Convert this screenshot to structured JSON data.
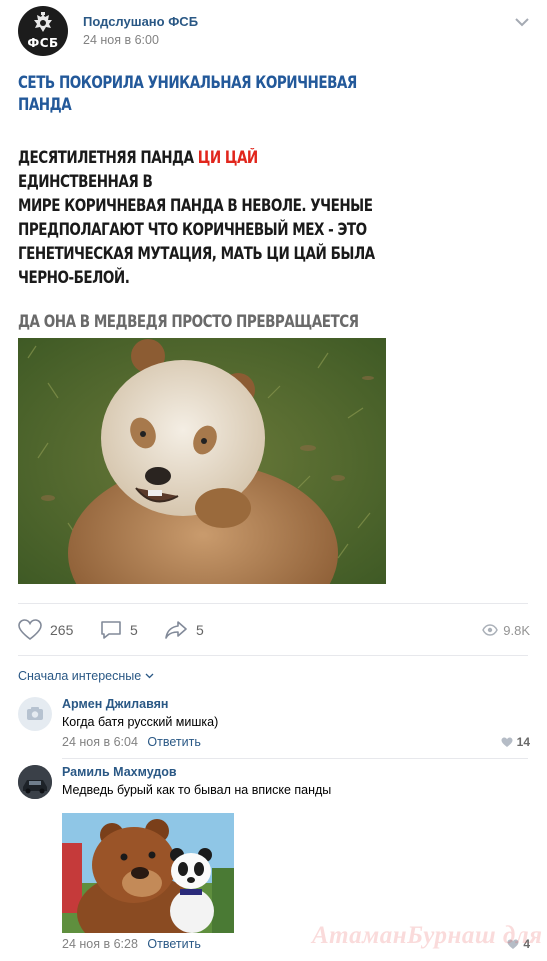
{
  "post": {
    "author": "Подслушано ФСБ",
    "avatar_text": "ФСБ",
    "date": "24 ноя в 6:00",
    "meme": {
      "title_line1": "Сеть покорила уникальная коричневая",
      "title_line2": "панда",
      "body_line1_a": "Десятилетняя панда ",
      "body_line1_red": "Ци Цай",
      "body_line1_b": " единственная в",
      "body_line2": "мире коричневая панда в неволе. Ученые",
      "body_line3": "предполагают что коричневый мех - это",
      "body_line4": "генетическая мутация, мать Ци Цай была",
      "body_line5": "черно-белой.",
      "subcaption": "Да она в медведя просто превращается"
    },
    "likes": "265",
    "comments": "5",
    "shares": "5",
    "views": "9.8K"
  },
  "comments_section": {
    "sort_label": "Сначала интересные",
    "items": [
      {
        "name": "Армен Джилавян",
        "text": "Когда батя русский мишка)",
        "date": "24 ноя в 6:04",
        "reply": "Ответить",
        "likes": "14"
      },
      {
        "name": "Рамиль Махмудов",
        "text": "Медведь бурый как то бывал на вписке панды",
        "date": "24 ноя в 6:28",
        "reply": "Ответить",
        "likes": "4"
      }
    ]
  },
  "watermark": "АтаманБурнаш для ЛП",
  "colors": {
    "link": "#2a5885",
    "meme_title": "#23599a",
    "meme_red": "#e1261c",
    "meta": "#828282"
  },
  "icons": [
    "fsb-emblem-icon",
    "chevron-down-icon",
    "heart-icon",
    "comment-icon",
    "share-icon",
    "eye-icon",
    "camera-icon"
  ]
}
